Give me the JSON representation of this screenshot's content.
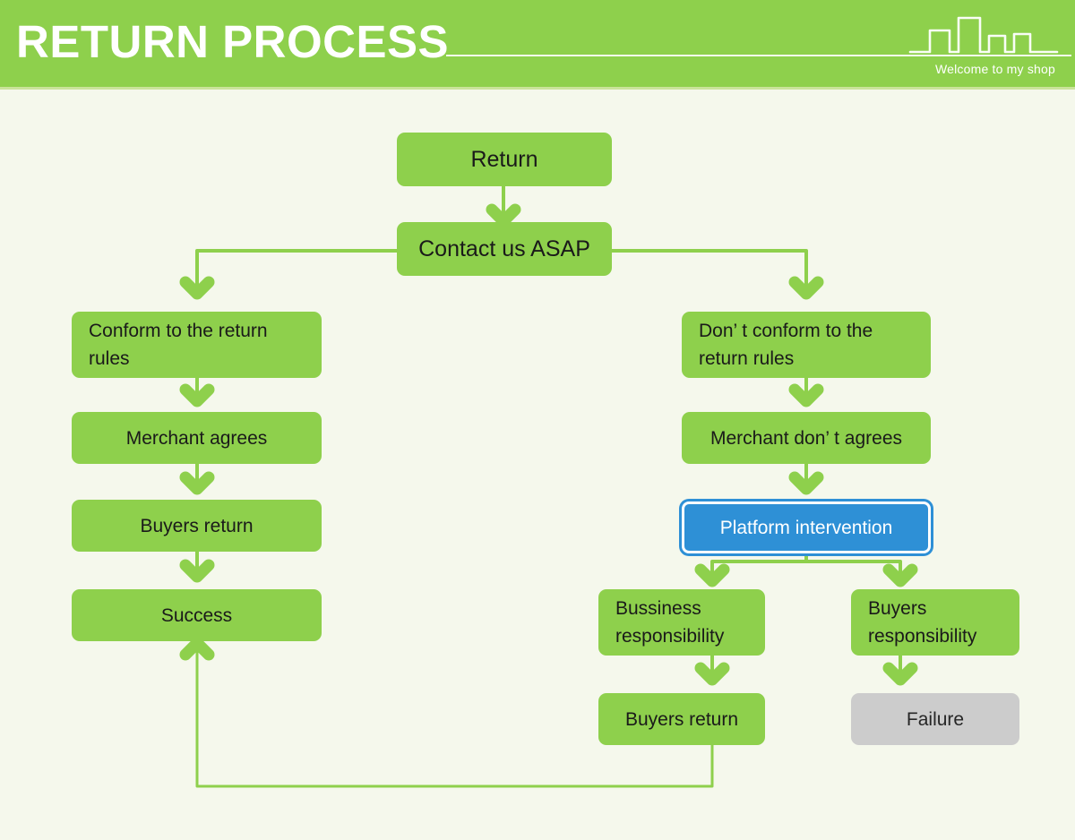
{
  "header": {
    "title": "RETURN PROCESS",
    "tagline": "Welcome to my shop",
    "brand_color": "#8ed04c",
    "title_color": "#ffffff",
    "skyline_icon": "city-skyline-outline-icon"
  },
  "canvas": {
    "background_color": "#f5f8ec",
    "node_color": "#8ed04c",
    "node_text_color": "#1a1a1a",
    "selected_color": "#2e90d6",
    "selected_text_color": "#ffffff",
    "failure_color": "#cccccc",
    "connector_color": "#8ed04c"
  },
  "flow": {
    "nodes": [
      {
        "id": "return",
        "label": "Return",
        "state": "normal"
      },
      {
        "id": "contact",
        "label": "Contact us ASAP",
        "state": "normal"
      },
      {
        "id": "conform",
        "label": "Conform to the return rules",
        "state": "normal"
      },
      {
        "id": "merchant-agrees",
        "label": "Merchant agrees",
        "state": "normal"
      },
      {
        "id": "buyers-return-left",
        "label": "Buyers return",
        "state": "normal"
      },
      {
        "id": "success",
        "label": "Success",
        "state": "normal"
      },
      {
        "id": "not-conform",
        "label": "Don’ t conform to the return rules",
        "state": "normal"
      },
      {
        "id": "merchant-disagrees",
        "label": "Merchant don’ t agrees",
        "state": "normal"
      },
      {
        "id": "platform",
        "label": "Platform intervention",
        "state": "selected"
      },
      {
        "id": "business-resp",
        "label": "Bussiness responsibility",
        "state": "normal"
      },
      {
        "id": "buyers-resp",
        "label": "Buyers responsibility",
        "state": "normal"
      },
      {
        "id": "buyers-return-right",
        "label": "Buyers return",
        "state": "normal"
      },
      {
        "id": "failure",
        "label": "Failure",
        "state": "failure"
      }
    ],
    "edges": [
      {
        "from": "return",
        "to": "contact"
      },
      {
        "from": "contact",
        "to": "conform"
      },
      {
        "from": "contact",
        "to": "not-conform"
      },
      {
        "from": "conform",
        "to": "merchant-agrees"
      },
      {
        "from": "merchant-agrees",
        "to": "buyers-return-left"
      },
      {
        "from": "buyers-return-left",
        "to": "success"
      },
      {
        "from": "not-conform",
        "to": "merchant-disagrees"
      },
      {
        "from": "merchant-disagrees",
        "to": "platform"
      },
      {
        "from": "platform",
        "to": "business-resp"
      },
      {
        "from": "platform",
        "to": "buyers-resp"
      },
      {
        "from": "business-resp",
        "to": "buyers-return-right"
      },
      {
        "from": "buyers-resp",
        "to": "failure"
      },
      {
        "from": "buyers-return-right",
        "to": "success"
      }
    ]
  }
}
